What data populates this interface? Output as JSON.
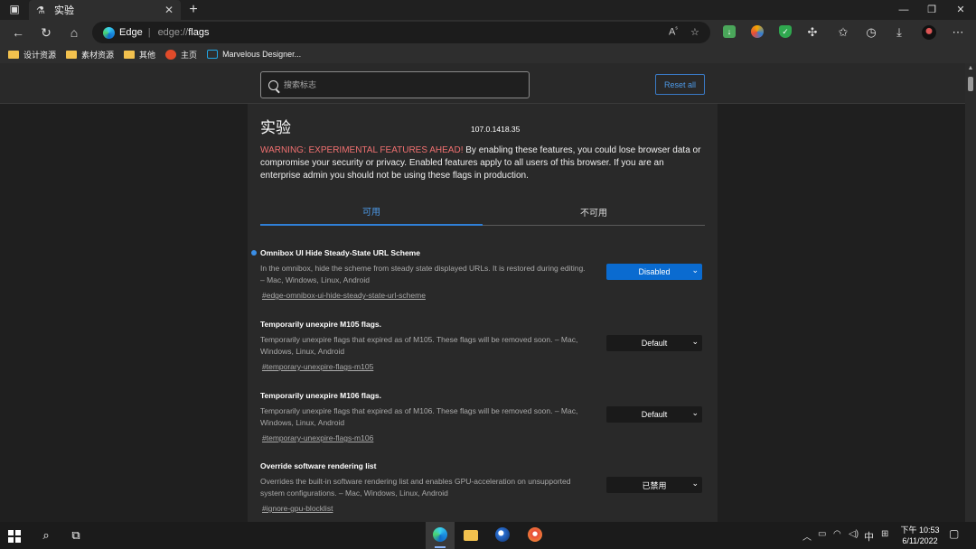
{
  "tab": {
    "title": "实验"
  },
  "address": {
    "brand": "Edge",
    "scheme": "edge://",
    "path": "flags"
  },
  "favorites": [
    {
      "label": "设计资源",
      "icon": "folder-icon"
    },
    {
      "label": "素材资源",
      "icon": "folder-icon"
    },
    {
      "label": "其他",
      "icon": "folder-icon"
    },
    {
      "label": "主页",
      "icon": "home-avatar-icon"
    },
    {
      "label": "Marvelous Designer...",
      "icon": "marvelous-designer-icon"
    }
  ],
  "search": {
    "placeholder": "搜索标志"
  },
  "reset": {
    "label": "Reset all"
  },
  "page": {
    "title": "实验",
    "version": "107.0.1418.35",
    "warning_strong": "WARNING: EXPERIMENTAL FEATURES AHEAD!",
    "warning_rest": " By enabling these features, you could lose browser data or compromise your security or privacy. Enabled features apply to all users of this browser. If you are an enterprise admin you should not be using these flags in production."
  },
  "tabs": {
    "available": "可用",
    "unavailable": "不可用"
  },
  "flags": [
    {
      "title": "Omnibox UI Hide Steady-State URL Scheme",
      "desc": "In the omnibox, hide the scheme from steady state displayed URLs. It is restored during editing. – Mac, Windows, Linux, Android",
      "link": "#edge-omnibox-ui-hide-steady-state-url-scheme",
      "value": "Disabled"
    },
    {
      "title": "Temporarily unexpire M105 flags.",
      "desc": "Temporarily unexpire flags that expired as of M105. These flags will be removed soon. – Mac, Windows, Linux, Android",
      "link": "#temporary-unexpire-flags-m105",
      "value": "Default"
    },
    {
      "title": "Temporarily unexpire M106 flags.",
      "desc": "Temporarily unexpire flags that expired as of M106. These flags will be removed soon. – Mac, Windows, Linux, Android",
      "link": "#temporary-unexpire-flags-m106",
      "value": "Default"
    },
    {
      "title": "Override software rendering list",
      "desc": "Overrides the built-in software rendering list and enables GPU-acceleration on unsupported system configurations. – Mac, Windows, Linux, Android",
      "link": "#ignore-gpu-blocklist",
      "value": "已禁用"
    }
  ],
  "taskbar": {
    "ime": "中",
    "time": "下午 10:53",
    "date": "6/11/2022"
  },
  "colors": {
    "accent": "#0a6bd0",
    "warning": "#f07070",
    "link": "#4d9ae8"
  }
}
